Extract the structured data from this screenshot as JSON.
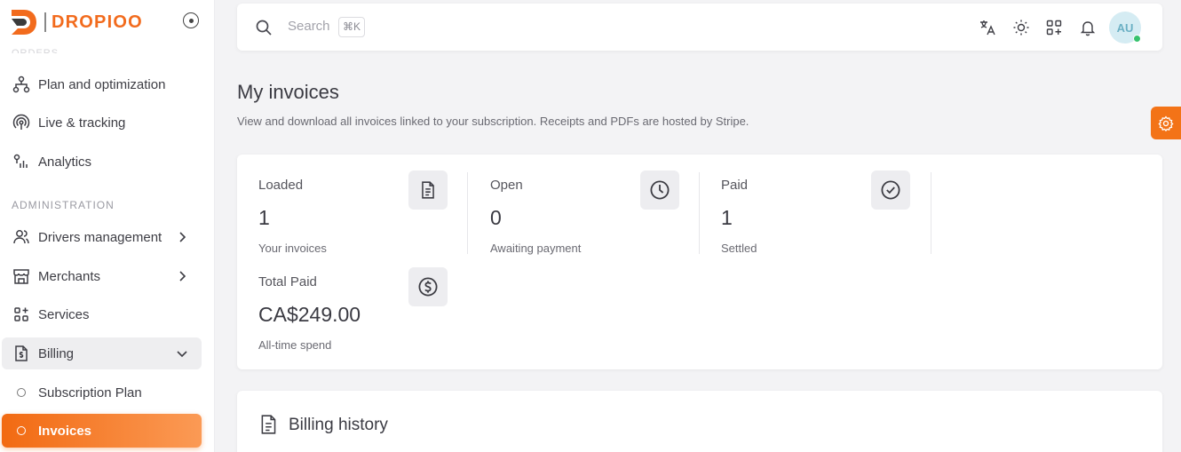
{
  "brand": {
    "name": "DROPIOO",
    "color": "#f26b1d"
  },
  "sidebar": {
    "cut_section_label": "ORDERS",
    "items_top": [
      {
        "label": "Plan and optimization",
        "icon": "route-icon"
      },
      {
        "label": "Live & tracking",
        "icon": "radar-icon"
      },
      {
        "label": "Analytics",
        "icon": "analytics-icon"
      }
    ],
    "section_admin": "ADMINISTRATION",
    "items_admin": [
      {
        "label": "Drivers management",
        "icon": "users-icon",
        "has_chevron": true
      },
      {
        "label": "Merchants",
        "icon": "store-icon",
        "has_chevron": true
      },
      {
        "label": "Services",
        "icon": "grid-icon"
      },
      {
        "label": "Billing",
        "icon": "receipt-icon",
        "expanded": true
      }
    ],
    "billing_children": [
      {
        "label": "Subscription Plan"
      },
      {
        "label": "Invoices",
        "active": true
      }
    ]
  },
  "topbar": {
    "search_placeholder": "Search",
    "shortcut": "⌘K",
    "avatar_initials": "AU",
    "icons": [
      "translate-icon",
      "theme-sun-icon",
      "apps-icon",
      "bell-icon"
    ]
  },
  "page": {
    "title": "My invoices",
    "subtitle": "View and download all invoices linked to your subscription. Receipts and PDFs are hosted by Stripe."
  },
  "stats": [
    {
      "label": "Loaded",
      "value": "1",
      "hint": "Your invoices",
      "icon": "file-invoice-icon"
    },
    {
      "label": "Open",
      "value": "0",
      "hint": "Awaiting payment",
      "icon": "clock-icon"
    },
    {
      "label": "Paid",
      "value": "1",
      "hint": "Settled",
      "icon": "check-circle-icon"
    },
    {
      "label": "Total Paid",
      "value": "CA$249.00",
      "hint": "All-time spend",
      "icon": "dollar-circle-icon"
    }
  ],
  "history": {
    "title": "Billing history"
  },
  "colors": {
    "accent": "#f37317",
    "online": "#37c26e"
  }
}
